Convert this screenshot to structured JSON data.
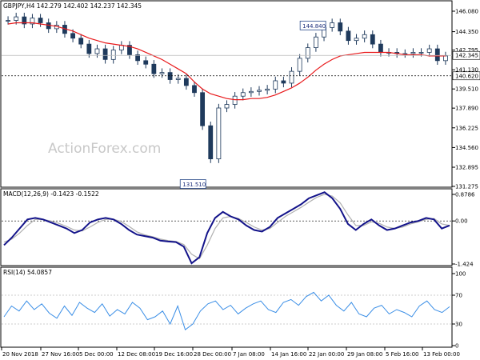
{
  "price_panel": {
    "header": "GBPJPY,H4  142.279 142.402 142.237 142.345",
    "watermark": "ActionForex.com",
    "y_ticks": [
      "146.080",
      "144.350",
      "142.795",
      "141.130",
      "139.510",
      "137.890",
      "136.225",
      "134.560",
      "132.895",
      "131.275"
    ],
    "current_label": "142.345",
    "hline_label": "140.620",
    "high_label": "144.840",
    "low_label": "131.510"
  },
  "macd_panel": {
    "header": "MACD(12,26,9) -0.1423 -0.1522",
    "y_ticks": [
      "0.8786",
      "0.00",
      "-1.424"
    ]
  },
  "rsi_panel": {
    "header": "RSI(14) 54.0857",
    "y_ticks": [
      "100",
      "70",
      "30",
      "0"
    ]
  },
  "x_labels": [
    "20 Nov 2018",
    "27 Nov 16:00",
    "5 Dec 00:00",
    "12 Dec 08:00",
    "19 Dec 16:00",
    "28 Dec 00:00",
    "7 Jan 08:00",
    "14 Jan 16:00",
    "22 Jan 00:00",
    "29 Jan 08:00",
    "5 Feb 16:00",
    "13 Feb 00:00"
  ],
  "colors": {
    "moving_average": "#e8191b",
    "macd": "#13138a",
    "signal": "#b0b0b0",
    "rsi": "#3a8ee6",
    "candles": "#1f3a5c"
  },
  "chart_data": [
    {
      "type": "line",
      "title": "GBPJPY,H4",
      "ylim": [
        131.275,
        146.08
      ],
      "series": [
        {
          "values": [
            145.3,
            145.6,
            145.0,
            145.5,
            145.1,
            144.6,
            144.9,
            144.2,
            143.8,
            143.3,
            142.5,
            142.9,
            142.0,
            142.8,
            143.2,
            142.4,
            141.9,
            141.6,
            140.8,
            140.9,
            140.3,
            140.4,
            139.8,
            139.2,
            136.4,
            133.6,
            137.9,
            138.2,
            138.9,
            139.2,
            139.3,
            139.4,
            139.5,
            140.2,
            140.0,
            141.0,
            142.1,
            143.0,
            143.9,
            144.7,
            145.1,
            144.4,
            143.6,
            143.8,
            144.1,
            143.3,
            142.6,
            142.6,
            142.5,
            142.5,
            142.6,
            142.6,
            142.9,
            141.9,
            142.3
          ]
        },
        {
          "name": "",
          "values": [
            145.0,
            145.1,
            145.1,
            145.1,
            145.0,
            144.9,
            144.8,
            144.6,
            144.4,
            144.1,
            143.8,
            143.6,
            143.4,
            143.3,
            143.2,
            143.1,
            142.9,
            142.6,
            142.3,
            142.0,
            141.6,
            141.2,
            140.8,
            140.1,
            139.5,
            139.1,
            138.9,
            138.7,
            138.6,
            138.6,
            138.7,
            138.7,
            138.8,
            139.0,
            139.3,
            139.6,
            140.0,
            140.5,
            141.1,
            141.6,
            142.0,
            142.3,
            142.4,
            142.5,
            142.6,
            142.6,
            142.6,
            142.6,
            142.5,
            142.4,
            142.4,
            142.4,
            142.3,
            142.3,
            142.3
          ]
        }
      ],
      "annotations": [
        "144.840",
        "131.510",
        "140.620"
      ]
    },
    {
      "type": "line",
      "title": "MACD(12,26,9)",
      "ylim": [
        -1.424,
        0.8786
      ],
      "series": [
        {
          "values": [
            -0.8,
            -0.55,
            -0.25,
            0.05,
            0.1,
            0.05,
            -0.05,
            -0.15,
            -0.25,
            -0.4,
            -0.3,
            -0.05,
            0.05,
            0.1,
            0.05,
            -0.1,
            -0.3,
            -0.45,
            -0.5,
            -0.55,
            -0.65,
            -0.68,
            -0.7,
            -0.85,
            -1.4,
            -1.2,
            -0.4,
            0.1,
            0.3,
            0.15,
            0.05,
            -0.15,
            -0.3,
            -0.35,
            -0.2,
            0.1,
            0.25,
            0.4,
            0.55,
            0.75,
            0.85,
            0.95,
            0.75,
            0.4,
            -0.1,
            -0.3,
            -0.1,
            0.05,
            -0.15,
            -0.3,
            -0.25,
            -0.15,
            -0.05,
            0.0,
            0.1,
            0.05,
            -0.25,
            -0.15
          ]
        },
        {
          "values": [
            -0.7,
            -0.6,
            -0.4,
            -0.15,
            0.05,
            0.05,
            0.0,
            -0.08,
            -0.18,
            -0.3,
            -0.33,
            -0.2,
            -0.05,
            0.05,
            0.06,
            -0.02,
            -0.18,
            -0.36,
            -0.46,
            -0.52,
            -0.6,
            -0.65,
            -0.68,
            -0.78,
            -1.1,
            -1.25,
            -0.8,
            -0.25,
            0.1,
            0.15,
            0.08,
            -0.05,
            -0.2,
            -0.3,
            -0.25,
            -0.05,
            0.15,
            0.3,
            0.45,
            0.62,
            0.78,
            0.88,
            0.82,
            0.6,
            0.2,
            -0.15,
            -0.15,
            -0.03,
            -0.08,
            -0.2,
            -0.25,
            -0.2,
            -0.1,
            -0.03,
            0.05,
            0.08,
            -0.1,
            -0.15
          ]
        }
      ]
    },
    {
      "type": "line",
      "title": "RSI(14)",
      "ylim": [
        0,
        100
      ],
      "series": [
        {
          "values": [
            40,
            55,
            48,
            62,
            50,
            58,
            45,
            38,
            55,
            42,
            60,
            52,
            46,
            58,
            41,
            50,
            44,
            60,
            52,
            36,
            40,
            48,
            30,
            55,
            22,
            30,
            48,
            58,
            62,
            50,
            56,
            44,
            52,
            58,
            62,
            50,
            46,
            60,
            64,
            56,
            68,
            74,
            62,
            70,
            56,
            48,
            60,
            44,
            40,
            52,
            56,
            44,
            50,
            46,
            40,
            55,
            62,
            50,
            46,
            54
          ]
        }
      ]
    }
  ]
}
